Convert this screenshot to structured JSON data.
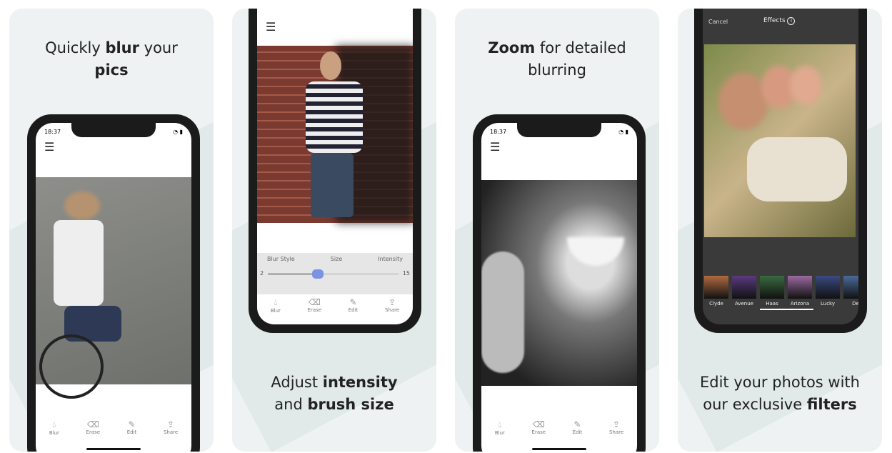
{
  "panels": [
    {
      "caption_pre": "Quickly ",
      "caption_bold": "blur",
      "caption_post": " your",
      "caption_line2_bold": "pics",
      "time": "18:37"
    },
    {
      "caption_pre": "Adjust ",
      "caption_bold": "intensity",
      "caption_line2_pre": "and ",
      "caption_line2_bold": "brush size",
      "controls": {
        "labels": [
          "Blur Style",
          "Size",
          "Intensity"
        ],
        "min": "2",
        "max": "15",
        "value_fraction": 0.38
      }
    },
    {
      "caption_bold": "Zoom",
      "caption_post": " for detailed",
      "caption_line2": "blurring",
      "time": "18:37"
    },
    {
      "caption_line1": "Edit your photos with",
      "caption_line2_pre": "our exclusive ",
      "caption_line2_bold": "filters",
      "header": {
        "cancel": "Cancel",
        "title": "Effects"
      },
      "filters": [
        "Clyde",
        "Avenue",
        "Haas",
        "Arizona",
        "Lucky",
        "De"
      ]
    }
  ],
  "toolbar": [
    {
      "label": "Blur",
      "icon": "droplet-icon"
    },
    {
      "label": "Erase",
      "icon": "eraser-icon"
    },
    {
      "label": "Edit",
      "icon": "pencil-icon"
    },
    {
      "label": "Share",
      "icon": "share-icon"
    }
  ],
  "colors": {
    "background": "#eef2f2",
    "slider_thumb": "#7b93e0",
    "dark_ui": "#3a3a3a"
  }
}
